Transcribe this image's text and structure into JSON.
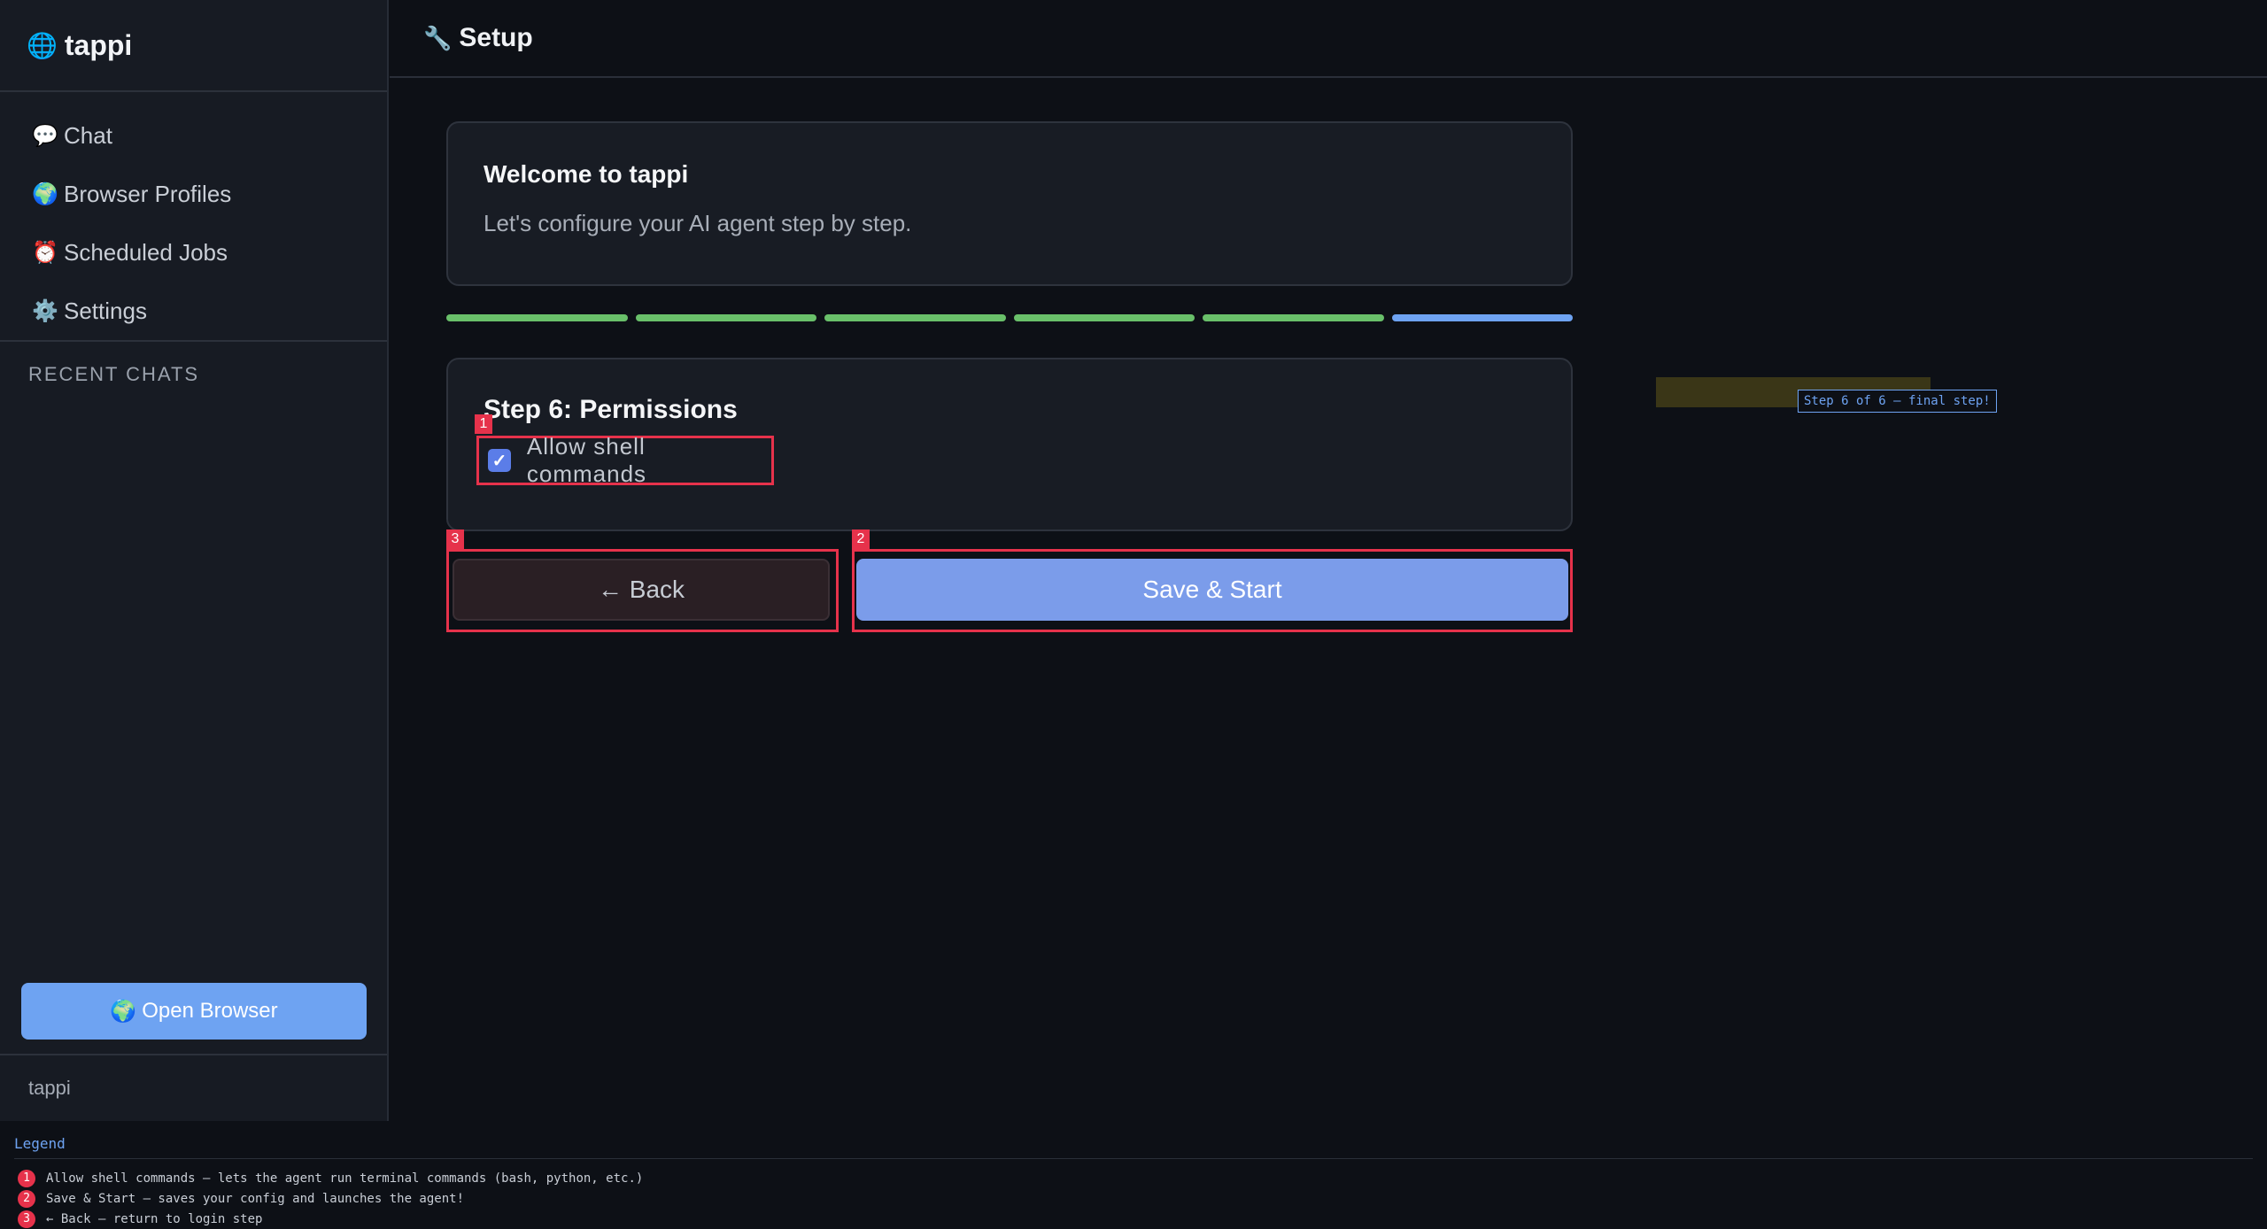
{
  "app": {
    "name": "tappi",
    "footer_name": "tappi"
  },
  "sidebar": {
    "items": [
      {
        "icon": "💬",
        "label": "Chat"
      },
      {
        "icon": "🌍",
        "label": "Browser Profiles"
      },
      {
        "icon": "⏰",
        "label": "Scheduled Jobs"
      },
      {
        "icon": "⚙️",
        "label": "Settings"
      }
    ],
    "recent_title": "RECENT CHATS",
    "open_browser": {
      "icon": "🌍",
      "label": "Open Browser"
    }
  },
  "header": {
    "icon": "🔧",
    "title": "Setup"
  },
  "welcome": {
    "title": "Welcome to tappi",
    "subtitle": "Let's configure your AI agent step by step."
  },
  "progress": {
    "total_steps": 6,
    "current_step": 6
  },
  "step": {
    "title": "Step 6: Permissions",
    "allow_shell": {
      "label": "Allow shell commands",
      "checked": true
    }
  },
  "buttons": {
    "back": "← Back",
    "save": "Save & Start"
  },
  "hint": {
    "text": "Step 6 of 6 — final step!"
  },
  "badges": {
    "shell": "1",
    "save": "2",
    "back": "3"
  },
  "legend": {
    "title": "Legend",
    "items": [
      {
        "num": "1",
        "text": "Allow shell commands — lets the agent run terminal commands (bash, python, etc.)"
      },
      {
        "num": "2",
        "text": "Save & Start — saves your config and launches the agent!"
      },
      {
        "num": "3",
        "text": "← Back — return to login step"
      }
    ]
  },
  "colors": {
    "accent": "#6ea3f2",
    "progress_done": "#69c06a",
    "annotation": "#e6324b",
    "save_button": "#7b9cea"
  }
}
